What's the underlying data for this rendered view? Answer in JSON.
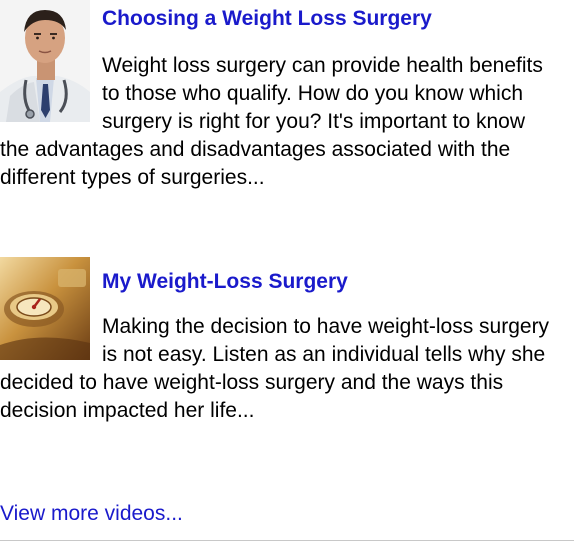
{
  "articles": [
    {
      "title": "Choosing a Weight Loss Surgery",
      "description": "Weight loss surgery can provide health benefits to those who qualify. How do you know which surgery is right for you? It's important to know the advantages and disadvantages associated with the different types of surgeries...",
      "thumbnail": "doctor-photo"
    },
    {
      "title": "My Weight-Loss Surgery",
      "description": "Making the decision to have weight-loss surgery is not easy. Listen as an individual tells why she decided to have weight-loss surgery and the ways this decision impacted her life...",
      "thumbnail": "scale-dial-photo"
    }
  ],
  "more_link": "View more videos...",
  "colors": {
    "link": "#1a1acb",
    "text": "#000000"
  }
}
